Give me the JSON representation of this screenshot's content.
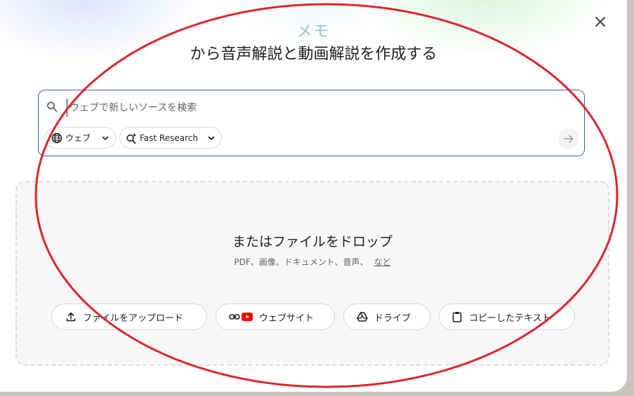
{
  "dialog": {
    "accent_title": "メモ",
    "title": "から音声解説と動画解説を作成する",
    "close_icon": "close-icon"
  },
  "search": {
    "placeholder": "ウェブで新しいソースを検索",
    "value": "",
    "icon": "search-icon",
    "source_chip": {
      "label": "ウェブ",
      "icon": "globe-icon"
    },
    "mode_chip": {
      "label": "Fast Research",
      "icon": "sparkle-search-icon"
    },
    "submit_icon": "arrow-right-icon"
  },
  "drop_zone": {
    "title": "またはファイルをドロップ",
    "subtitle": "PDF、画像、ドキュメント、音声、",
    "more_link": "など",
    "buttons": [
      {
        "label": "ファイルをアップロード",
        "icon": "upload-icon"
      },
      {
        "label": "ウェブサイト",
        "icon": "link-icon"
      },
      {
        "label": "ドライブ",
        "icon": "drive-icon"
      },
      {
        "label": "コピーしたテキスト",
        "icon": "clipboard-icon"
      }
    ]
  },
  "colors": {
    "accent_title": "#8ec6d9",
    "search_border": "#3f5ea8",
    "annotation_ellipse": "#e0242b",
    "youtube_red": "#ff0000"
  }
}
